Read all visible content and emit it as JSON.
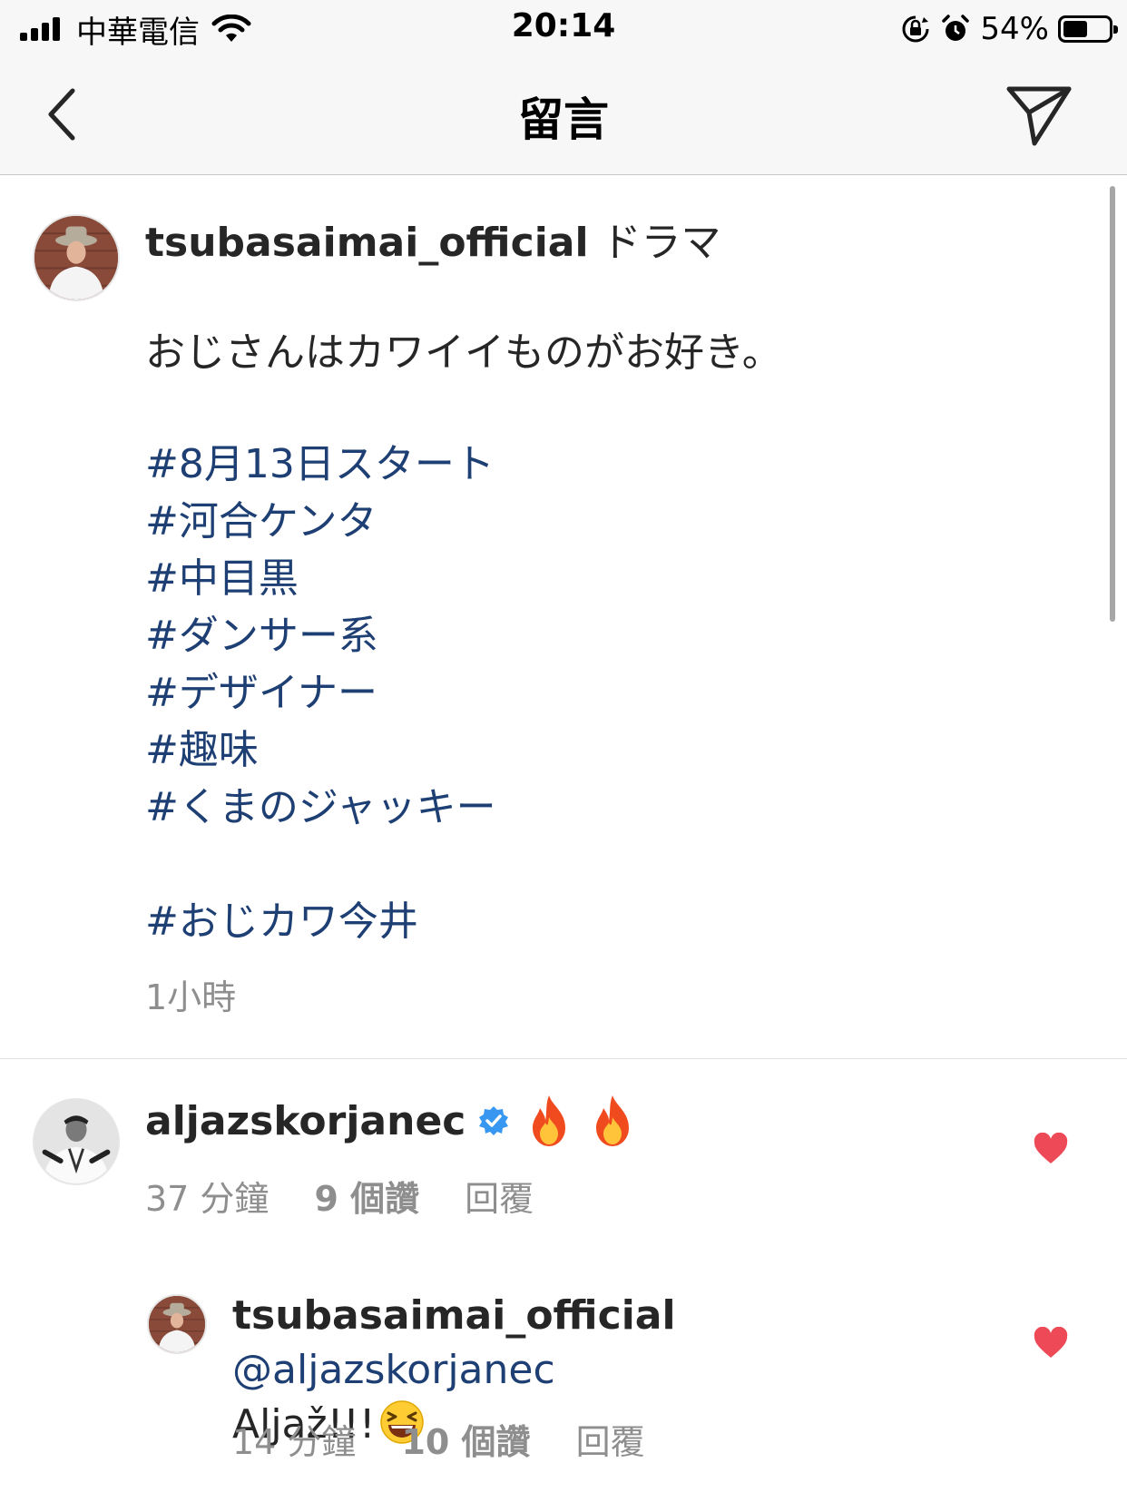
{
  "status_bar": {
    "carrier": "中華電信",
    "time": "20:14",
    "battery_percent": "54%",
    "battery_level": 0.54,
    "icons": [
      "signal-icon",
      "wifi-icon",
      "orientation-lock-icon",
      "alarm-icon",
      "battery-icon"
    ]
  },
  "header": {
    "title": "留言",
    "back_icon": "chevron-left-icon",
    "send_icon": "send-icon"
  },
  "caption": {
    "username": "tsubasaimai_official",
    "first_line": "ドラマ",
    "body": "おじさんはカワイイものがお好き。",
    "hashtags": [
      "#8月13日スタート",
      "#河合ケンタ",
      "#中目黒",
      "#ダンサー系",
      "#デザイナー",
      "#趣味",
      "#くまのジャッキー"
    ],
    "extra_hashtag": "#おじカワ今井",
    "time": "1小時"
  },
  "comments": [
    {
      "username": "aljazskorjanec",
      "verified": true,
      "text_emoji": [
        "fire-icon",
        "fire-icon"
      ],
      "time": "37 分鐘",
      "likes": "9 個讚",
      "reply_label": "回覆",
      "liked": true,
      "heart_color": "#ed4956"
    }
  ],
  "reply": {
    "username": "tsubasaimai_official",
    "mention": "@aljazskorjanec",
    "text": "Aljaž!!!",
    "emoji": "laughing-face-icon",
    "time": "14 分鐘",
    "likes": "10 個讚",
    "reply_label": "回覆",
    "liked": true
  },
  "colors": {
    "hashtag": "#1e3f73",
    "muted": "#8e8e8e",
    "verified": "#3897f0",
    "heart": "#ed4956"
  }
}
